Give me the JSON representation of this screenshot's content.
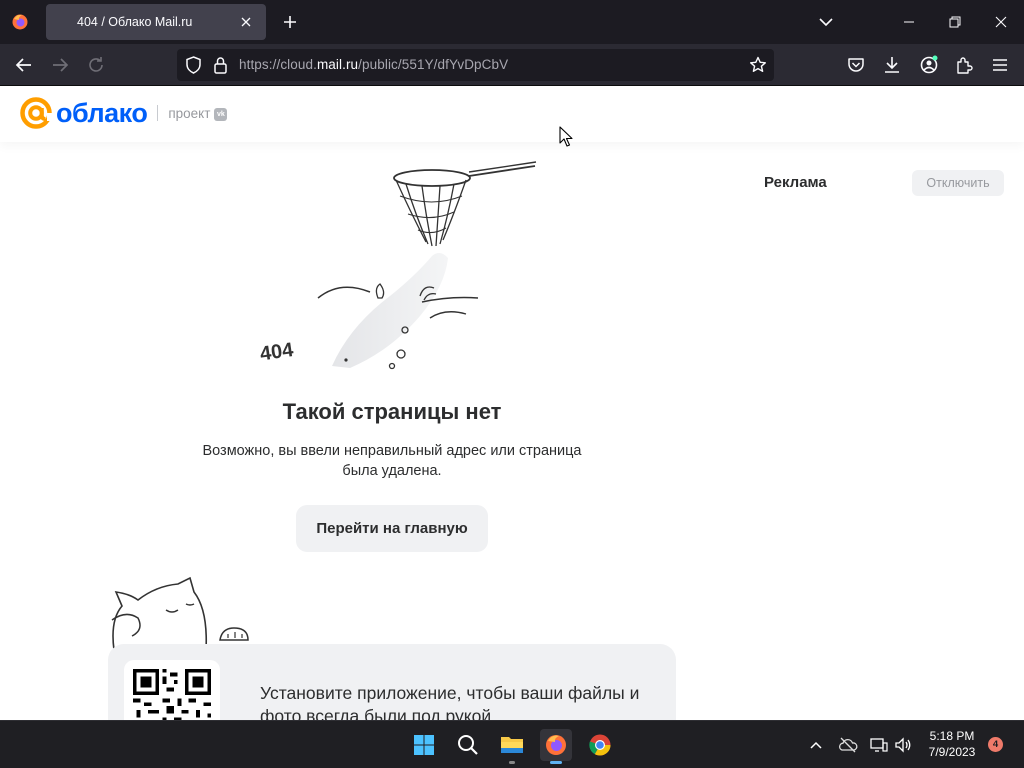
{
  "browser": {
    "tab_title": "404 / Облако Mail.ru",
    "url_prefix": "https://cloud.",
    "url_host": "mail.ru",
    "url_path": "/public/551Y/dfYvDpCbV"
  },
  "page": {
    "logo_text": "облако",
    "logo_project": "проект",
    "logo_badge": "vk",
    "illustration_label": "404",
    "error_title": "Такой страницы нет",
    "error_text": "Возможно, вы ввели неправильный адрес или страница была удалена.",
    "home_button": "Перейти на главную",
    "promo_text": "Установите приложение, чтобы ваши файлы и фото всегда были под рукой",
    "ad_label": "Реклама",
    "ad_disable_button": "Отключить"
  },
  "taskbar": {
    "time": "5:18 PM",
    "date": "7/9/2023",
    "notifications": "4"
  },
  "colors": {
    "brand_blue": "#005ff9",
    "brand_orange": "#ff9e00",
    "chrome_dark": "#1c1b22",
    "taskbar": "#1f1f23"
  }
}
